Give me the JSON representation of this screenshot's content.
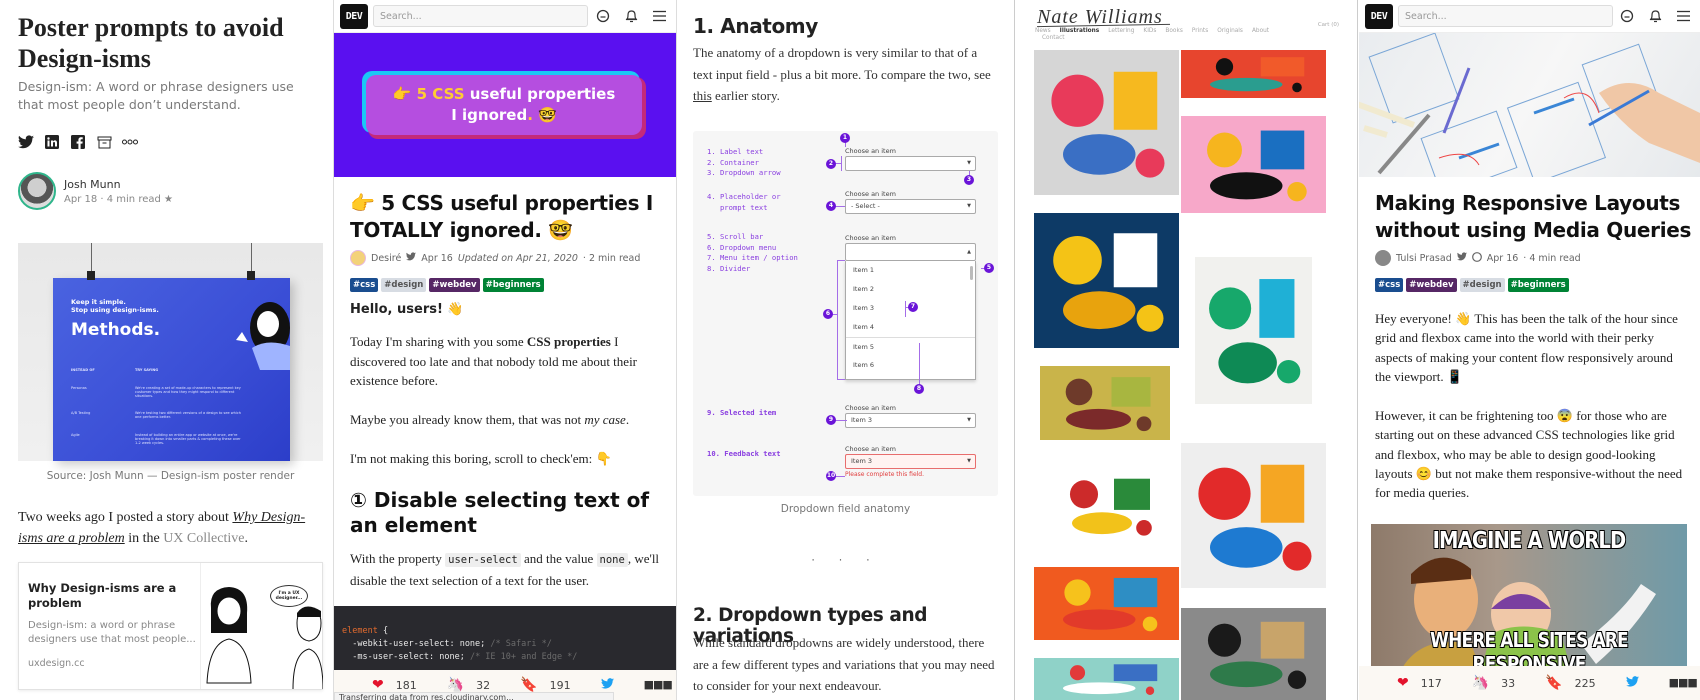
{
  "panel1": {
    "title": "Poster prompts to avoid Design-isms",
    "subtitle": "Design-ism: A word or phrase designers use that most people don’t understand.",
    "share_icons": [
      "twitter-icon",
      "linkedin-icon",
      "facebook-icon",
      "bookmark-icon",
      "more-icon"
    ],
    "author": {
      "name": "Josh Munn",
      "meta": "Apr 18 · 4 min read ★"
    },
    "poster": {
      "kicker": "Keep it simple.\nStop using design-isms.",
      "heading": "Methods.",
      "col_headers": [
        "INSTEAD OF",
        "TRY SAYING"
      ],
      "rows": [
        {
          "term": "Personas",
          "alt": "We're creating a set of made-up characters to represent key customer types and how they might respond to different situations."
        },
        {
          "term": "A/B Testing",
          "alt": "We're testing two different versions of a design to see which one performs better."
        },
        {
          "term": "Agile",
          "alt": "Instead of building an entire app or website at once, we're breaking it down into smaller parts & completing these over 1-2 week cycles."
        }
      ]
    },
    "caption": "Source: Josh Munn — Design-ism poster render",
    "para": {
      "before": "Two weeks ago I posted a story about ",
      "link": "Why Design-isms are a problem",
      "middle": " in the ",
      "collective": "UX Collective",
      "after": "."
    },
    "card": {
      "title": "Why Design-isms are a problem",
      "desc": "Design-ism: a word or phrase designers use that most people...",
      "domain": "uxdesign.cc",
      "bubble": "I'm a UX designer..."
    }
  },
  "panel2": {
    "logo": "DEV",
    "search_placeholder": "Search...",
    "hero": {
      "pre": "👉 ",
      "highlight": "5 CSS",
      "rest1": " useful properties",
      "rest2": "I ignored",
      "dot": ".",
      "emoji": " 🤓"
    },
    "title": "👉 5 CSS useful properties I TOTALLY ignored. 🤓",
    "meta": {
      "author": "Desiré",
      "date": "Apr 16",
      "updated": "Updated on Apr 21, 2020",
      "read": "· 2 min read"
    },
    "tags": [
      {
        "label": "#css",
        "color": "#1a4d8f"
      },
      {
        "label": "#design",
        "color": "#d7dce3",
        "text": "#555"
      },
      {
        "label": "#webdev",
        "color": "#562765"
      },
      {
        "label": "#beginners",
        "color": "#008335"
      }
    ],
    "hello": "Hello, users! 👋",
    "p1_before": "Today I'm sharing with you some ",
    "p1_bold": "CSS properties",
    "p1_after": " I discovered too late and that nobody told me about their existence before.",
    "p2_before": "Maybe you already know them, that was not ",
    "p2_italic": "my case",
    "p2_after": ".",
    "p3": "I'm not making this boring, scroll to check'em: 👇",
    "h2": "① Disable selecting text of an element",
    "p4_a": "With the property ",
    "p4_code1": "user-select",
    "p4_b": " and the value ",
    "p4_code2": "none",
    "p4_c": ", we'll disable the text selection of a text for the user.",
    "code": {
      "selector": "element",
      "brace": " {",
      "line1": "  -webkit-user-select: none;",
      "line1_comment": " /* Safari */",
      "line2": "  -ms-user-select: none;",
      "line2_comment": " /* IE 10+ and Edge */"
    },
    "reactions": {
      "hearts": "181",
      "unicorns": "32",
      "saves": "191"
    },
    "status": "Transferring data from res.cloudinary.com..."
  },
  "panel3": {
    "h1": "1. Anatomy",
    "p1_before": "The anatomy of a dropdown is very similar to that of a text input field - plus a bit more. To compare the two, see ",
    "p1_link": "this",
    "p1_after": " earlier story.",
    "legend": {
      "g1": "1. Label text\n2. Container\n3. Dropdown arrow",
      "g2": "4. Placeholder or\n   prompt text",
      "g3": "5. Scroll bar\n6. Dropdown menu\n7. Menu item / option\n8. Divider",
      "g4": "9. Selected item",
      "g5": "10. Feedback text"
    },
    "label": "Choose an item",
    "placeholder": "- Select -",
    "menu_items": [
      "Item 1",
      "Item 2",
      "Item 3",
      "Item 4",
      "Item 5",
      "Item 6"
    ],
    "selected": "Item 3",
    "error_value": "Item 3",
    "error_text": "Please complete this field.",
    "markers": [
      "1",
      "2",
      "3",
      "4",
      "5",
      "6",
      "7",
      "8",
      "9",
      "10"
    ],
    "caption": "Dropdown field anatomy",
    "separator": "· · ·",
    "h2": "2. Dropdown types and variations",
    "p2": "While standard dropdowns are widely understood, there are a few different types and variations that you may need to consider for your next endeavour."
  },
  "panel4": {
    "logo": "Nate Williams",
    "nav": [
      "News",
      "Illustrations",
      "Lettering",
      "KIDs",
      "Books",
      "Prints",
      "Originals",
      "About"
    ],
    "nav_active": "Illustrations",
    "nav2": "Contact",
    "cart": "Cart (0)",
    "tiles": [
      {
        "name": "birds-illustration",
        "colors": [
          "#d6d6d6",
          "#e83a5a",
          "#f6b91f",
          "#3a6fc4"
        ]
      },
      {
        "name": "tree-triptych-illustration",
        "colors": [
          "#e7452e",
          "#111",
          "#f15a2a",
          "#2a9d8f"
        ]
      },
      {
        "name": "good-soul-illustration",
        "colors": [
          "#f7a8c9",
          "#f6b51e",
          "#1a6fc1",
          "#111"
        ]
      },
      {
        "name": "folk-plants-illustration",
        "colors": [
          "#0d3a66",
          "#f4c316",
          "#ffffff",
          "#e8a30d"
        ]
      },
      {
        "name": "green-sun-print",
        "colors": [
          "#f1f1ee",
          "#17a86b",
          "#1fb0d6",
          "#0e8a55"
        ]
      },
      {
        "name": "brazil-packaging",
        "colors": [
          "#c9b44a",
          "#6e3a2a",
          "#a8b640",
          "#7b2a2a"
        ]
      },
      {
        "name": "dancers-illustration",
        "colors": [
          "#eeeeee",
          "#e22a2a",
          "#f5a623",
          "#1e7ad1"
        ]
      },
      {
        "name": "book-covers",
        "colors": [
          "#ffffff",
          "#cc2a2a",
          "#2a8a3a",
          "#f2c21a"
        ]
      },
      {
        "name": "city-panels-illustration",
        "colors": [
          "#f05a1f",
          "#f6c21c",
          "#2e8ec4",
          "#e23a2a"
        ]
      },
      {
        "name": "botanical-circles",
        "colors": [
          "#8a8a8a",
          "#1a1a1a",
          "#c8a46a",
          "#2e7a4a"
        ]
      },
      {
        "name": "cushions",
        "colors": [
          "#8fd2c8",
          "#e23a3a",
          "#3a6fc4",
          "#ffffff"
        ]
      }
    ]
  },
  "panel5": {
    "logo": "DEV",
    "search_placeholder": "Search...",
    "title": "Making Responsive Layouts without using Media Queries",
    "meta": {
      "author": "Tulsi Prasad",
      "date": "Apr 16",
      "read": "· 4 min read"
    },
    "tags": [
      {
        "label": "#css",
        "color": "#1a4d8f"
      },
      {
        "label": "#webdev",
        "color": "#562765"
      },
      {
        "label": "#design",
        "color": "#d7dce3",
        "text": "#555"
      },
      {
        "label": "#beginners",
        "color": "#008335"
      }
    ],
    "p1": "Hey everyone! 👋 This has been the talk of the hour since grid and flexbox came into the world with their perky aspects of making your content flow responsively around the viewport. 📱",
    "p2": "However, it can be frightening too 😨 for those who are starting out on these advanced CSS technologies like grid and flexbox, who may be able to design good-looking layouts 😊 but not make them responsive-without the need for media queries.",
    "meme_top": "IMAGINE A WORLD",
    "meme_bottom": "WHERE ALL SITES ARE RESPONSIVE",
    "reactions": {
      "hearts": "117",
      "unicorns": "33",
      "saves": "225"
    }
  }
}
